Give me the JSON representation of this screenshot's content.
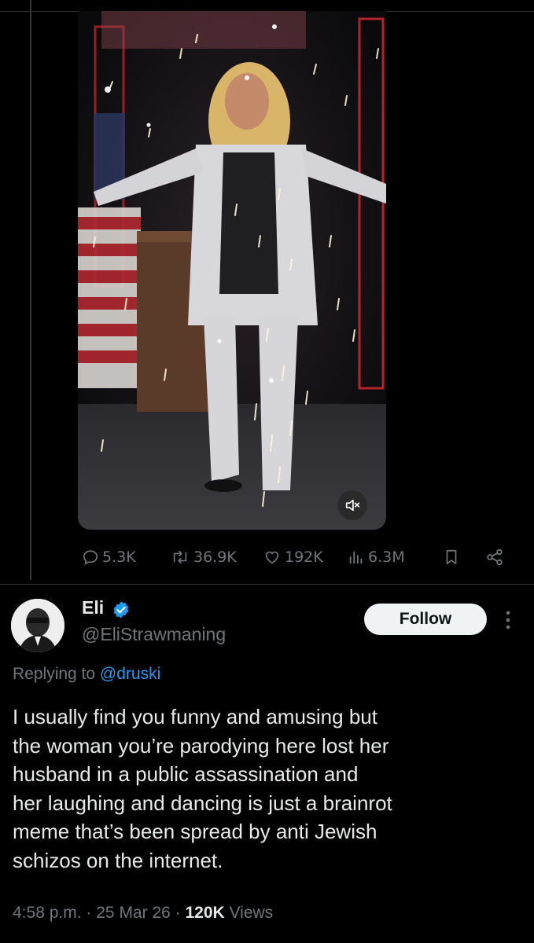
{
  "tweet": {
    "stats": {
      "replies": "5.3K",
      "reposts": "36.9K",
      "likes": "192K",
      "views": "6.3M"
    }
  },
  "reply": {
    "name": "Eli",
    "handle": "@EliStrawmaning",
    "follow_label": "Follow",
    "replying_prefix": "Replying to",
    "replying_to": "@druski",
    "text": "I usually find you funny and amusing but\nthe woman you’re parodying here lost her\nhusband in a public assassination and\nher laughing and dancing is just a brainrot\nmeme that’s been spread by anti Jewish\nschizos on the internet.",
    "time": "4:58 p.m.",
    "date": "25 Mar 26",
    "views_count": "120K",
    "views_label": "Views"
  },
  "icons": {
    "reply": "speech-bubble-icon",
    "repost": "repost-icon",
    "like": "heart-icon",
    "views": "bar-chart-icon",
    "bookmark": "bookmark-icon",
    "share": "share-icon",
    "mute": "muted-speaker-icon",
    "verified": "verified-badge-icon",
    "more": "more-vertical-icon"
  },
  "colors": {
    "background": "#000000",
    "text": "#e7e9ea",
    "muted": "#71767b",
    "accent": "#1d9bf0",
    "follow_bg": "#eff3f4"
  }
}
